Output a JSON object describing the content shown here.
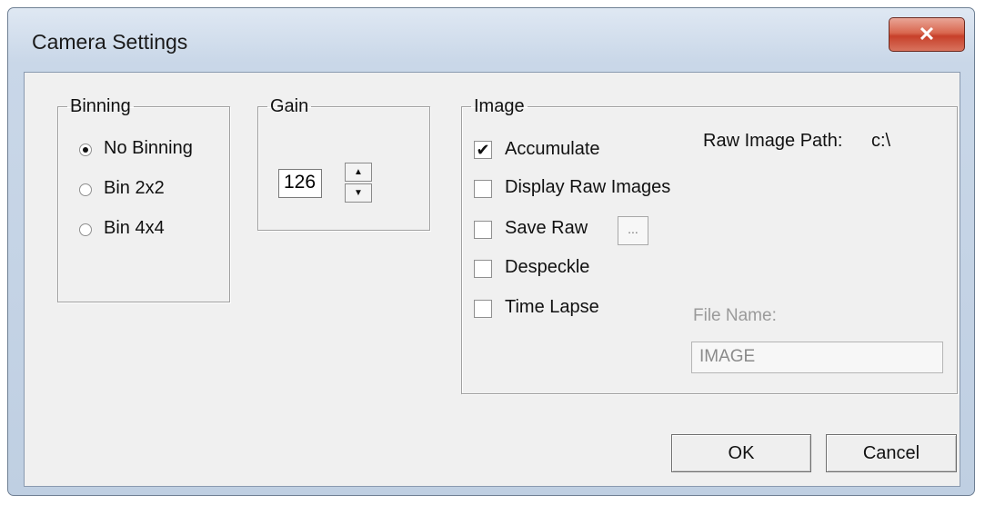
{
  "window": {
    "title": "Camera Settings",
    "close_glyph": "✕"
  },
  "binning": {
    "legend": "Binning",
    "options": [
      {
        "label": "No Binning",
        "selected": true
      },
      {
        "label": "Bin 2x2",
        "selected": false
      },
      {
        "label": "Bin 4x4",
        "selected": false
      }
    ]
  },
  "gain": {
    "legend": "Gain",
    "value": "126",
    "up_glyph": "▲",
    "down_glyph": "▼"
  },
  "image": {
    "legend": "Image",
    "raw_path_label": "Raw Image Path:",
    "raw_path_value": "c:\\",
    "accumulate": {
      "label": "Accumulate",
      "checked": true
    },
    "display_raw": {
      "label": "Display Raw Images",
      "checked": false
    },
    "save_raw": {
      "label": "Save Raw",
      "checked": false
    },
    "browse_label": "...",
    "despeckle": {
      "label": "Despeckle",
      "checked": false
    },
    "time_lapse": {
      "label": "Time Lapse",
      "checked": false
    },
    "file_name_label": "File Name:",
    "file_name_value": "IMAGE"
  },
  "buttons": {
    "ok": "OK",
    "cancel": "Cancel"
  },
  "colors": {
    "close_button": "#c7402a",
    "dialog_bg": "#f0f0f0",
    "frame": "#c9d7e8"
  }
}
